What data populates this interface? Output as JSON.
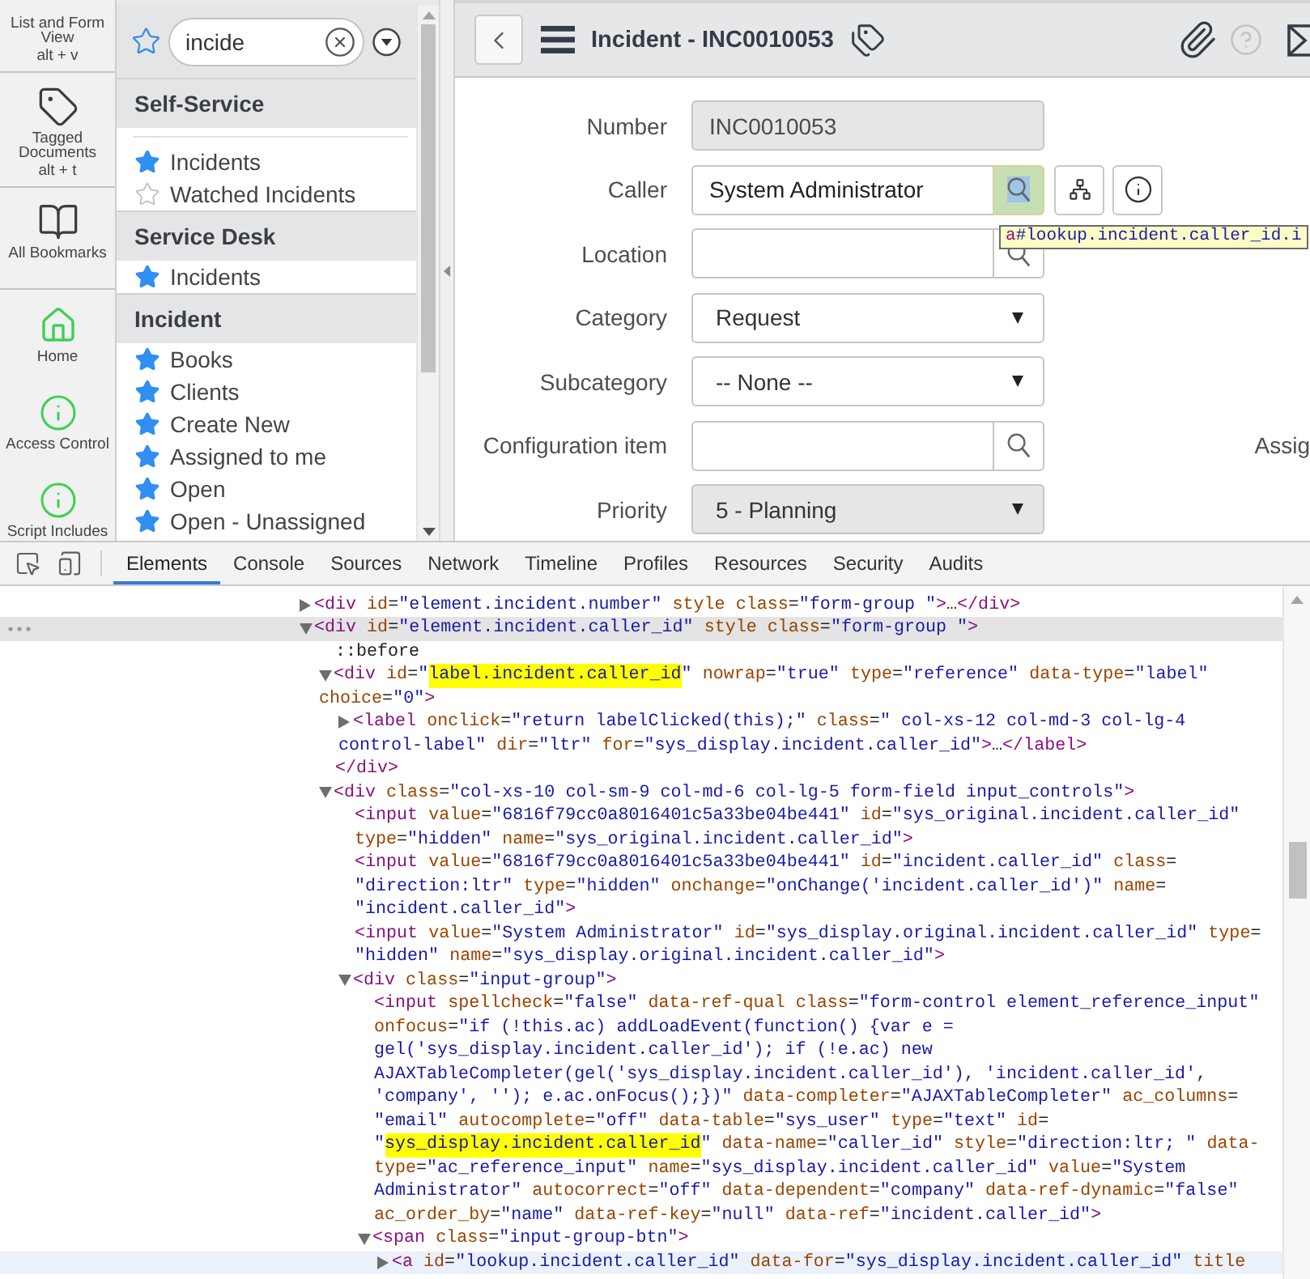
{
  "icon_bar": {
    "shortcuts": [
      {
        "kind": "list",
        "label": "List and Form View",
        "shortcut": "alt + v"
      },
      {
        "kind": "tag",
        "label": "Tagged Documents",
        "shortcut": "alt + t"
      },
      {
        "kind": "book",
        "label": "All Bookmarks"
      }
    ],
    "favorites": [
      {
        "kind": "home",
        "label": "Home"
      },
      {
        "kind": "info",
        "label": "Access Control"
      },
      {
        "kind": "info",
        "label": "Script Includes"
      }
    ]
  },
  "nav": {
    "filter": {
      "value": "incide"
    },
    "sections": [
      {
        "title": "Self-Service",
        "items": [
          {
            "label": "Incidents",
            "favorite": true
          },
          {
            "label": "Watched Incidents",
            "favorite": false
          }
        ]
      },
      {
        "title": "Service Desk",
        "items": [
          {
            "label": "Incidents",
            "favorite": true
          }
        ]
      },
      {
        "title": "Incident",
        "items": [
          {
            "label": "Books",
            "favorite": true
          },
          {
            "label": "Clients",
            "favorite": true
          },
          {
            "label": "Create New",
            "favorite": true
          },
          {
            "label": "Assigned to me",
            "favorite": true
          },
          {
            "label": "Open",
            "favorite": true
          },
          {
            "label": "Open - Unassigned",
            "favorite": true
          }
        ]
      }
    ]
  },
  "form": {
    "title": "Incident - INC0010053",
    "fields": [
      {
        "label": "Number",
        "kind": "text",
        "readonly": true,
        "value": "INC0010053"
      },
      {
        "label": "Caller",
        "kind": "reference",
        "readonly": false,
        "value": "System Administrator",
        "lookup_highlighted": true,
        "actions": true,
        "tooltip": {
          "tag": "a",
          "selector": "#lookup.incident.caller_id.i"
        }
      },
      {
        "label": "Location",
        "kind": "reference",
        "readonly": false,
        "lookup_highlighted": false,
        "actions": false
      },
      {
        "label": "Category",
        "kind": "select",
        "readonly": false,
        "value": "Request"
      },
      {
        "label": "Subcategory",
        "kind": "select",
        "readonly": false,
        "value": "-- None --"
      },
      {
        "label": "Configuration item",
        "kind": "reference",
        "readonly": false,
        "lookup_highlighted": false,
        "actions": false,
        "right_label": "Assig"
      },
      {
        "label": "Priority",
        "kind": "select",
        "readonly": true,
        "value": "5 - Planning"
      }
    ]
  },
  "devtools": {
    "tabs": [
      {
        "label": "Elements",
        "selected": true
      },
      {
        "label": "Console",
        "selected": false
      },
      {
        "label": "Sources",
        "selected": false
      },
      {
        "label": "Network",
        "selected": false
      },
      {
        "label": "Timeline",
        "selected": false
      },
      {
        "label": "Profiles",
        "selected": false
      },
      {
        "label": "Resources",
        "selected": false
      },
      {
        "label": "Security",
        "selected": false
      },
      {
        "label": "Audits",
        "selected": false
      }
    ],
    "tree": [
      {
        "expanded": false,
        "selected": false,
        "hovered": false,
        "lines": [
          "<div id=\"element.incident.number\" style class=\"form-group \">…</div>"
        ]
      },
      {
        "expanded": true,
        "selected": true,
        "hovered": false,
        "lines": [
          "<div id=\"element.incident.caller_id\" style class=\"form-group \">"
        ],
        "children": [
          {
            "selected": false,
            "hovered": false,
            "lines": [
              "::before"
            ]
          },
          {
            "expanded": true,
            "selected": false,
            "hovered": false,
            "lines": [
              [
                {
                  "text": "<div id=\"",
                  "highlighted": false
                },
                {
                  "text": "label.incident.caller_id",
                  "highlighted": true
                },
                {
                  "text": "\" nowrap=\"true\" type=\"reference\" data-type=\"label\"",
                  "highlighted": false
                }
              ],
              "choice=\"0\">"
            ],
            "children": [
              {
                "expanded": false,
                "selected": false,
                "hovered": false,
                "lines": [
                  "<label onclick=\"return labelClicked(this);\" class=\" col-xs-12 col-md-3 col-lg-4",
                  "control-label\" dir=\"ltr\" for=\"sys_display.incident.caller_id\">…</label>"
                ]
              }
            ],
            "closing": "</div>"
          },
          {
            "expanded": true,
            "selected": false,
            "hovered": false,
            "lines": [
              "<div class=\"col-xs-10 col-sm-9 col-md-6 col-lg-5 form-field input_controls\">"
            ],
            "children": [
              {
                "selected": false,
                "hovered": false,
                "lines": [
                  "<input value=\"6816f79cc0a8016401c5a33be04be441\" id=\"sys_original.incident.caller_id\"",
                  "type=\"hidden\" name=\"sys_original.incident.caller_id\">"
                ]
              },
              {
                "selected": false,
                "hovered": false,
                "lines": [
                  "<input value=\"6816f79cc0a8016401c5a33be04be441\" id=\"incident.caller_id\" class=",
                  "\"direction:ltr\" type=\"hidden\" onchange=\"onChange('incident.caller_id')\" name=",
                  "\"incident.caller_id\">"
                ]
              },
              {
                "selected": false,
                "hovered": false,
                "lines": [
                  "<input value=\"System Administrator\" id=\"sys_display.original.incident.caller_id\" type=",
                  "\"hidden\" name=\"sys_display.original.incident.caller_id\">"
                ]
              },
              {
                "expanded": true,
                "selected": false,
                "hovered": false,
                "lines": [
                  "<div class=\"input-group\">"
                ],
                "children": [
                  {
                    "selected": false,
                    "hovered": false,
                    "lines": [
                      "<input spellcheck=\"false\" data-ref-qual class=\"form-control element_reference_input\"",
                      "onfocus=\"if (!this.ac) addLoadEvent(function() {var e =",
                      "gel('sys_display.incident.caller_id'); if (!e.ac) new",
                      "AJAXTableCompleter(gel('sys_display.incident.caller_id'), 'incident.caller_id',",
                      "'company', ''); e.ac.onFocus();})\" data-completer=\"AJAXTableCompleter\" ac_columns=",
                      "\"email\" autocomplete=\"off\" data-table=\"sys_user\" type=\"text\" id=",
                      [
                        {
                          "text": "\"",
                          "highlighted": false
                        },
                        {
                          "text": "sys_display.incident.caller_id",
                          "highlighted": true
                        },
                        {
                          "text": "\" data-name=\"caller_id\" style=\"direction:ltr; \" data-",
                          "highlighted": false
                        }
                      ],
                      "type=\"ac_reference_input\" name=\"sys_display.incident.caller_id\" value=\"System",
                      "Administrator\" autocorrect=\"off\" data-dependent=\"company\" data-ref-dynamic=\"false\"",
                      "ac_order_by=\"name\" data-ref-key=\"null\" data-ref=\"incident.caller_id\">"
                    ]
                  },
                  {
                    "expanded": true,
                    "selected": false,
                    "hovered": false,
                    "lines": [
                      "<span class=\"input-group-btn\">"
                    ],
                    "children": [
                      {
                        "expanded": false,
                        "selected": false,
                        "hovered": true,
                        "lines": [
                          "<a id=\"lookup.incident.caller_id\" data-for=\"sys_display.incident.caller_id\" title"
                        ]
                      }
                    ]
                  }
                ]
              }
            ]
          }
        ]
      }
    ]
  }
}
